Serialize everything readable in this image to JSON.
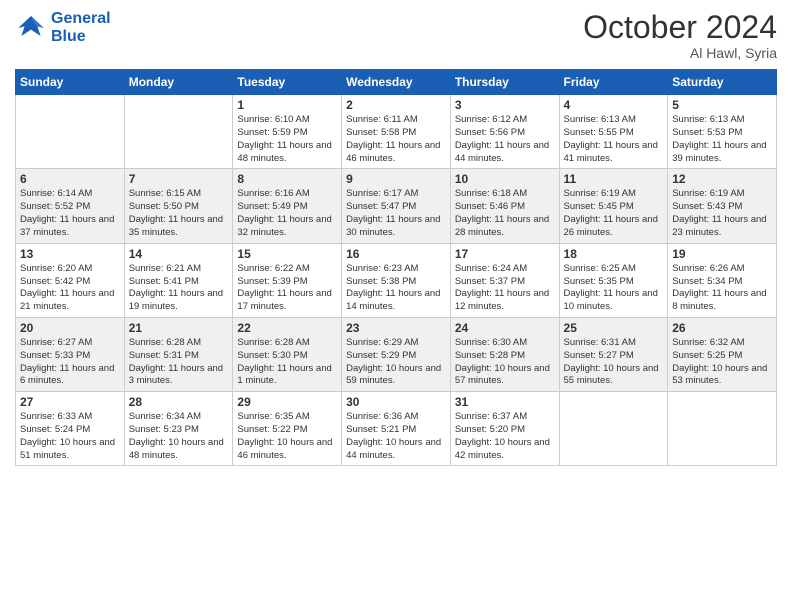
{
  "header": {
    "logo_line1": "General",
    "logo_line2": "Blue",
    "month": "October 2024",
    "location": "Al Hawl, Syria"
  },
  "weekdays": [
    "Sunday",
    "Monday",
    "Tuesday",
    "Wednesday",
    "Thursday",
    "Friday",
    "Saturday"
  ],
  "weeks": [
    [
      {
        "day": "",
        "info": ""
      },
      {
        "day": "",
        "info": ""
      },
      {
        "day": "1",
        "info": "Sunrise: 6:10 AM\nSunset: 5:59 PM\nDaylight: 11 hours and 48 minutes."
      },
      {
        "day": "2",
        "info": "Sunrise: 6:11 AM\nSunset: 5:58 PM\nDaylight: 11 hours and 46 minutes."
      },
      {
        "day": "3",
        "info": "Sunrise: 6:12 AM\nSunset: 5:56 PM\nDaylight: 11 hours and 44 minutes."
      },
      {
        "day": "4",
        "info": "Sunrise: 6:13 AM\nSunset: 5:55 PM\nDaylight: 11 hours and 41 minutes."
      },
      {
        "day": "5",
        "info": "Sunrise: 6:13 AM\nSunset: 5:53 PM\nDaylight: 11 hours and 39 minutes."
      }
    ],
    [
      {
        "day": "6",
        "info": "Sunrise: 6:14 AM\nSunset: 5:52 PM\nDaylight: 11 hours and 37 minutes."
      },
      {
        "day": "7",
        "info": "Sunrise: 6:15 AM\nSunset: 5:50 PM\nDaylight: 11 hours and 35 minutes."
      },
      {
        "day": "8",
        "info": "Sunrise: 6:16 AM\nSunset: 5:49 PM\nDaylight: 11 hours and 32 minutes."
      },
      {
        "day": "9",
        "info": "Sunrise: 6:17 AM\nSunset: 5:47 PM\nDaylight: 11 hours and 30 minutes."
      },
      {
        "day": "10",
        "info": "Sunrise: 6:18 AM\nSunset: 5:46 PM\nDaylight: 11 hours and 28 minutes."
      },
      {
        "day": "11",
        "info": "Sunrise: 6:19 AM\nSunset: 5:45 PM\nDaylight: 11 hours and 26 minutes."
      },
      {
        "day": "12",
        "info": "Sunrise: 6:19 AM\nSunset: 5:43 PM\nDaylight: 11 hours and 23 minutes."
      }
    ],
    [
      {
        "day": "13",
        "info": "Sunrise: 6:20 AM\nSunset: 5:42 PM\nDaylight: 11 hours and 21 minutes."
      },
      {
        "day": "14",
        "info": "Sunrise: 6:21 AM\nSunset: 5:41 PM\nDaylight: 11 hours and 19 minutes."
      },
      {
        "day": "15",
        "info": "Sunrise: 6:22 AM\nSunset: 5:39 PM\nDaylight: 11 hours and 17 minutes."
      },
      {
        "day": "16",
        "info": "Sunrise: 6:23 AM\nSunset: 5:38 PM\nDaylight: 11 hours and 14 minutes."
      },
      {
        "day": "17",
        "info": "Sunrise: 6:24 AM\nSunset: 5:37 PM\nDaylight: 11 hours and 12 minutes."
      },
      {
        "day": "18",
        "info": "Sunrise: 6:25 AM\nSunset: 5:35 PM\nDaylight: 11 hours and 10 minutes."
      },
      {
        "day": "19",
        "info": "Sunrise: 6:26 AM\nSunset: 5:34 PM\nDaylight: 11 hours and 8 minutes."
      }
    ],
    [
      {
        "day": "20",
        "info": "Sunrise: 6:27 AM\nSunset: 5:33 PM\nDaylight: 11 hours and 6 minutes."
      },
      {
        "day": "21",
        "info": "Sunrise: 6:28 AM\nSunset: 5:31 PM\nDaylight: 11 hours and 3 minutes."
      },
      {
        "day": "22",
        "info": "Sunrise: 6:28 AM\nSunset: 5:30 PM\nDaylight: 11 hours and 1 minute."
      },
      {
        "day": "23",
        "info": "Sunrise: 6:29 AM\nSunset: 5:29 PM\nDaylight: 10 hours and 59 minutes."
      },
      {
        "day": "24",
        "info": "Sunrise: 6:30 AM\nSunset: 5:28 PM\nDaylight: 10 hours and 57 minutes."
      },
      {
        "day": "25",
        "info": "Sunrise: 6:31 AM\nSunset: 5:27 PM\nDaylight: 10 hours and 55 minutes."
      },
      {
        "day": "26",
        "info": "Sunrise: 6:32 AM\nSunset: 5:25 PM\nDaylight: 10 hours and 53 minutes."
      }
    ],
    [
      {
        "day": "27",
        "info": "Sunrise: 6:33 AM\nSunset: 5:24 PM\nDaylight: 10 hours and 51 minutes."
      },
      {
        "day": "28",
        "info": "Sunrise: 6:34 AM\nSunset: 5:23 PM\nDaylight: 10 hours and 48 minutes."
      },
      {
        "day": "29",
        "info": "Sunrise: 6:35 AM\nSunset: 5:22 PM\nDaylight: 10 hours and 46 minutes."
      },
      {
        "day": "30",
        "info": "Sunrise: 6:36 AM\nSunset: 5:21 PM\nDaylight: 10 hours and 44 minutes."
      },
      {
        "day": "31",
        "info": "Sunrise: 6:37 AM\nSunset: 5:20 PM\nDaylight: 10 hours and 42 minutes."
      },
      {
        "day": "",
        "info": ""
      },
      {
        "day": "",
        "info": ""
      }
    ]
  ]
}
